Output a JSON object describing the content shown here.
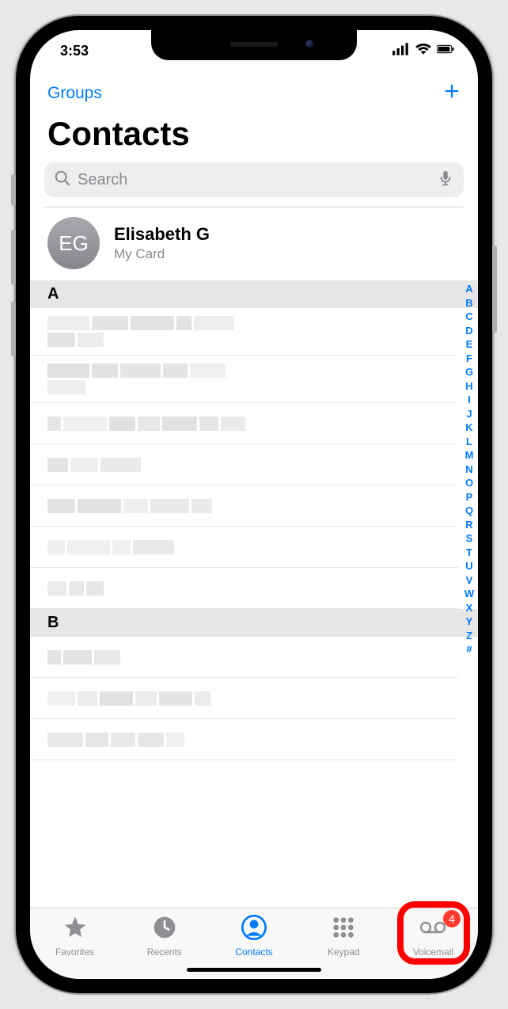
{
  "status": {
    "time": "3:53"
  },
  "nav": {
    "groups": "Groups"
  },
  "title": "Contacts",
  "search": {
    "placeholder": "Search"
  },
  "mycard": {
    "initials": "EG",
    "name": "Elisabeth G",
    "sub": "My Card"
  },
  "sections": [
    {
      "letter": "A",
      "rows": 7
    },
    {
      "letter": "B",
      "rows": 3
    }
  ],
  "index": [
    "A",
    "B",
    "C",
    "D",
    "E",
    "F",
    "G",
    "H",
    "I",
    "J",
    "K",
    "L",
    "M",
    "N",
    "O",
    "P",
    "Q",
    "R",
    "S",
    "T",
    "U",
    "V",
    "W",
    "X",
    "Y",
    "Z",
    "#"
  ],
  "tabs": {
    "favorites": "Favorites",
    "recents": "Recents",
    "contacts": "Contacts",
    "keypad": "Keypad",
    "voicemail": "Voicemail"
  },
  "voicemail_badge": "4"
}
